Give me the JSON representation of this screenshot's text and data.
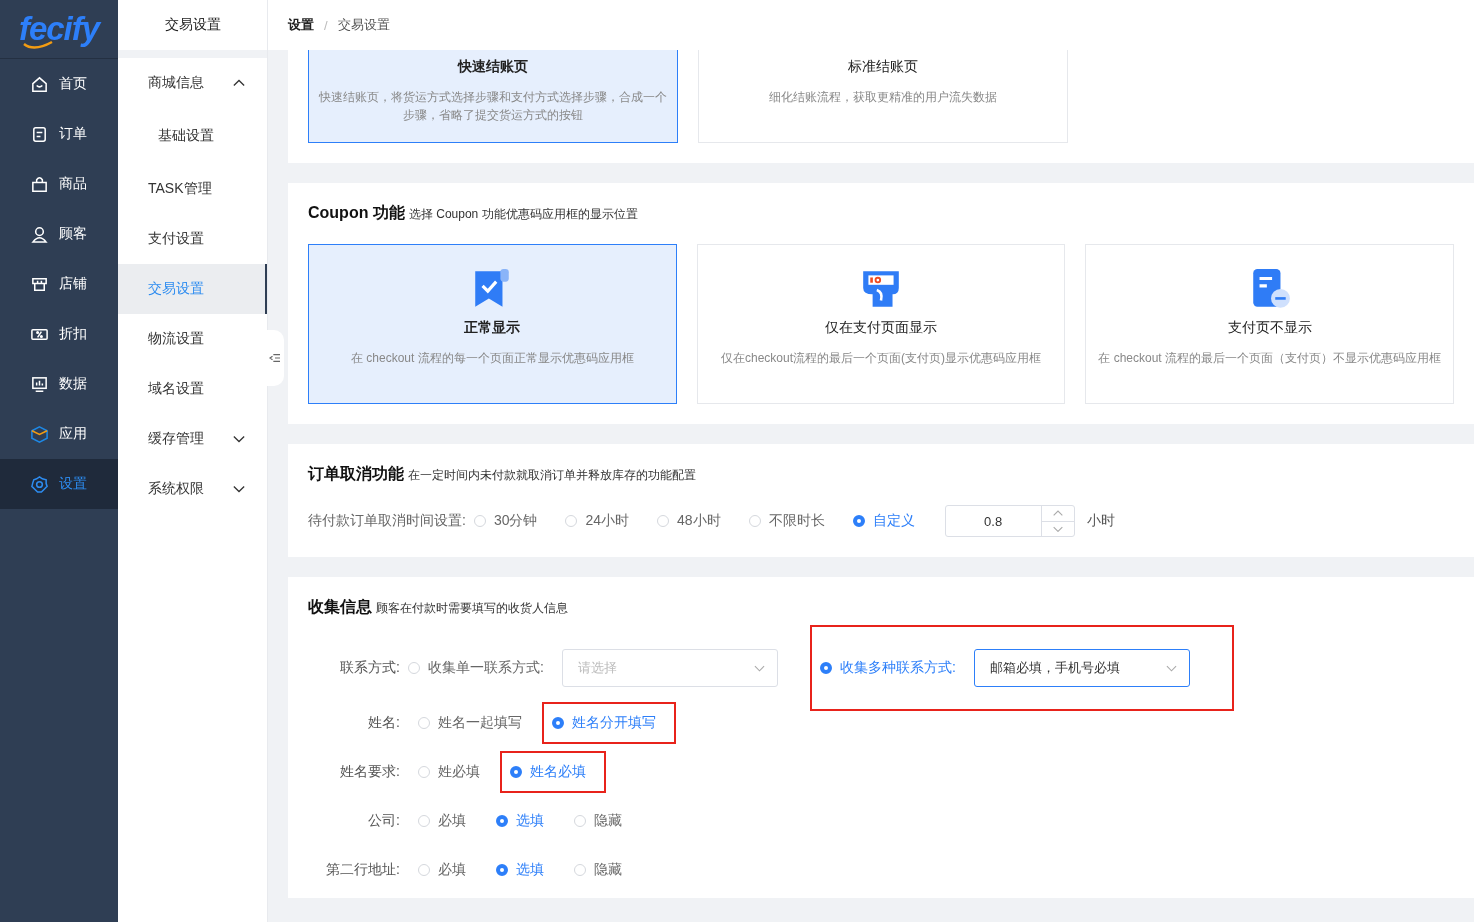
{
  "logo": "fecify",
  "nav": [
    {
      "label": "首页",
      "selected": false
    },
    {
      "label": "订单",
      "selected": false
    },
    {
      "label": "商品",
      "selected": false
    },
    {
      "label": "顾客",
      "selected": false
    },
    {
      "label": "店铺",
      "selected": false
    },
    {
      "label": "折扣",
      "selected": false
    },
    {
      "label": "数据",
      "selected": false
    },
    {
      "label": "应用",
      "selected": false
    },
    {
      "label": "设置",
      "selected": true
    }
  ],
  "submenu": {
    "title": "交易设置",
    "items": [
      {
        "label": "商城信息",
        "selected": false,
        "expanded": true,
        "children": [
          {
            "label": "基础设置",
            "selected": false
          }
        ]
      },
      {
        "label": "TASK管理",
        "selected": false
      },
      {
        "label": "支付设置",
        "selected": false
      },
      {
        "label": "交易设置",
        "selected": true
      },
      {
        "label": "物流设置",
        "selected": false
      },
      {
        "label": "域名设置",
        "selected": false
      },
      {
        "label": "缓存管理",
        "selected": false,
        "expanded": false
      },
      {
        "label": "系统权限",
        "selected": false,
        "expanded": false
      }
    ]
  },
  "breadcrumb": {
    "separator": "/",
    "items": [
      "设置",
      "交易设置"
    ]
  },
  "checkout": {
    "cards": [
      {
        "title": "快速结账页",
        "description": "快速结账页，将货运方式选择步骤和支付方式选择步骤，合成一个步骤，省略了提交货运方式的按钮",
        "selected": true
      },
      {
        "title": "标准结账页",
        "description": "细化结账流程，获取更精准的用户流失数据",
        "selected": false
      }
    ]
  },
  "coupon": {
    "title": "Coupon 功能",
    "subtitle": "选择 Coupon 功能优惠码应用框的显示位置",
    "cards": [
      {
        "title": "正常显示",
        "description": "在 checkout 流程的每一个页面正常显示优惠码应用框",
        "selected": true
      },
      {
        "title": "仅在支付页面显示",
        "description": "仅在checkout流程的最后一个页面(支付页)显示优惠码应用框",
        "selected": false
      },
      {
        "title": "支付页不显示",
        "description": "在 checkout 流程的最后一个页面（支付页）不显示优惠码应用框",
        "selected": false
      }
    ]
  },
  "cancel": {
    "title": "订单取消功能",
    "subtitle": "在一定时间内未付款就取消订单并释放库存的功能配置",
    "label": "待付款订单取消时间设置:",
    "options": [
      {
        "label": "30分钟",
        "selected": false
      },
      {
        "label": "24小时",
        "selected": false
      },
      {
        "label": "48小时",
        "selected": false
      },
      {
        "label": "不限时长",
        "selected": false
      },
      {
        "label": "自定义",
        "selected": true
      }
    ],
    "custom_value": "0.8",
    "unit": "小时"
  },
  "collect": {
    "title": "收集信息",
    "subtitle": "顾客在付款时需要填写的收货人信息",
    "contact": {
      "label": "联系方式:",
      "options": [
        {
          "label": "收集单一联系方式:",
          "selected": false,
          "highlighted": false,
          "placeholder": "请选择"
        },
        {
          "label": "收集多种联系方式:",
          "selected": true,
          "highlighted": true,
          "value": "邮箱必填，手机号必填"
        }
      ]
    },
    "rows": [
      {
        "label": "姓名:",
        "options": [
          {
            "label": "姓名一起填写",
            "selected": false,
            "highlighted": false
          },
          {
            "label": "姓名分开填写",
            "selected": true,
            "highlighted": true
          }
        ]
      },
      {
        "label": "姓名要求:",
        "options": [
          {
            "label": "姓必填",
            "selected": false,
            "highlighted": false
          },
          {
            "label": "姓名必填",
            "selected": true,
            "highlighted": true
          }
        ]
      },
      {
        "label": "公司:",
        "options": [
          {
            "label": "必填",
            "selected": false,
            "highlighted": false
          },
          {
            "label": "选填",
            "selected": true,
            "highlighted": false
          },
          {
            "label": "隐藏",
            "selected": false,
            "highlighted": false
          }
        ]
      },
      {
        "label": "第二行地址:",
        "options": [
          {
            "label": "必填",
            "selected": false,
            "highlighted": false
          },
          {
            "label": "选填",
            "selected": true,
            "highlighted": false
          },
          {
            "label": "隐藏",
            "selected": false,
            "highlighted": false
          }
        ]
      }
    ]
  }
}
